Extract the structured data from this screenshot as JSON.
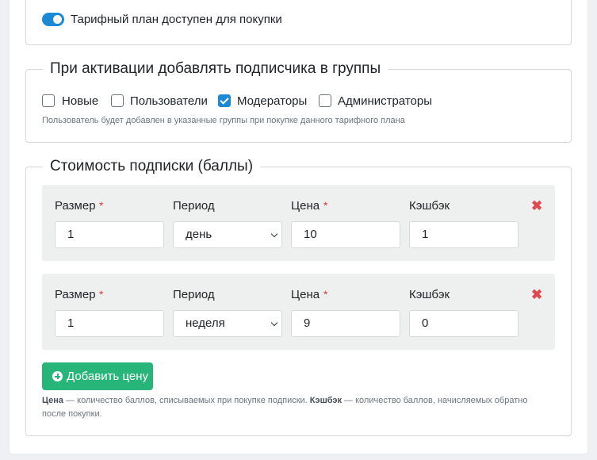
{
  "toggle": {
    "label": "Тарифный план доступен для покупки",
    "on": true
  },
  "groups": {
    "title": "При активации добавлять подписчика в группы",
    "options": [
      {
        "label": "Новые",
        "checked": false
      },
      {
        "label": "Пользователи",
        "checked": false
      },
      {
        "label": "Модераторы",
        "checked": true
      },
      {
        "label": "Администраторы",
        "checked": false
      }
    ],
    "help": "Пользователь будет добавлен в указанные группы при покупке данного тарифного плана"
  },
  "price": {
    "title": "Стоимость подписки (баллы)",
    "labels": {
      "size": "Размер",
      "period": "Период",
      "price": "Цена",
      "cashback": "Кэшбэк",
      "required_mark": "*",
      "remove": "✖"
    },
    "rows": [
      {
        "size": "1",
        "period": "день",
        "price": "10",
        "cashback": "1"
      },
      {
        "size": "1",
        "period": "неделя",
        "price": "9",
        "cashback": "0"
      }
    ],
    "add_button": "Добавить цену",
    "help": {
      "price_term": "Цена",
      "price_text": " — количество баллов, списываемых при покупке подписки. ",
      "cashback_term": "Кэшбэк",
      "cashback_text": " — количество баллов, начисляемых обратно после покупки."
    }
  },
  "colors": {
    "accent": "#1a8ad6",
    "success": "#27b57a",
    "danger": "#e0484d"
  }
}
